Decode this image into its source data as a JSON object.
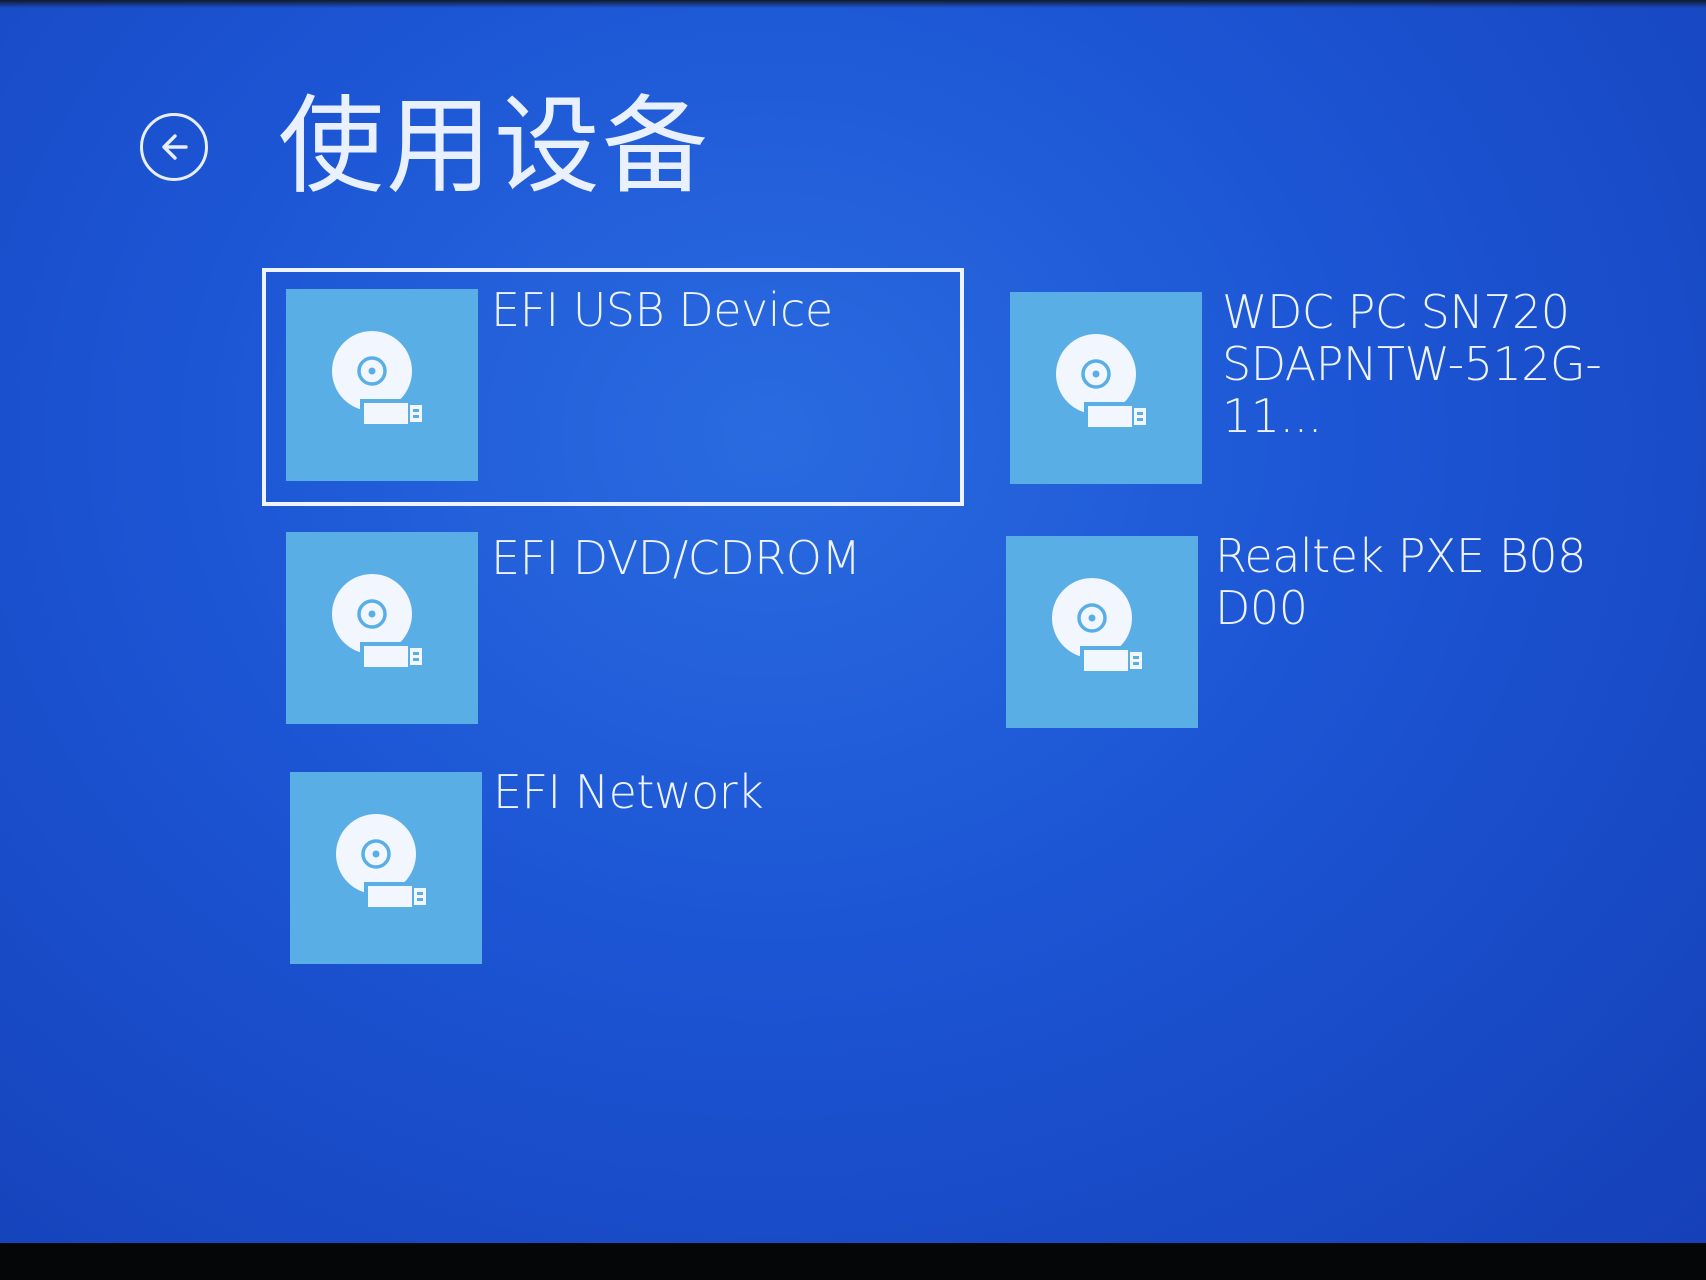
{
  "header": {
    "title": "使用设备"
  },
  "devices": [
    {
      "label": "EFI USB Device",
      "icon": "disk-usb-icon",
      "selected": true
    },
    {
      "label": "WDC PC SN720\nSDAPNTW-512G-11...",
      "icon": "disk-usb-icon",
      "selected": false
    },
    {
      "label": "EFI DVD/CDROM",
      "icon": "disk-usb-icon",
      "selected": false
    },
    {
      "label": "Realtek PXE B08\nD00",
      "icon": "disk-usb-icon",
      "selected": false
    },
    {
      "label": "EFI Network",
      "icon": "disk-usb-icon",
      "selected": false
    }
  ],
  "colors": {
    "background": "#1c55d4",
    "tile": "#5aaee6",
    "text": "#eef3ff"
  }
}
